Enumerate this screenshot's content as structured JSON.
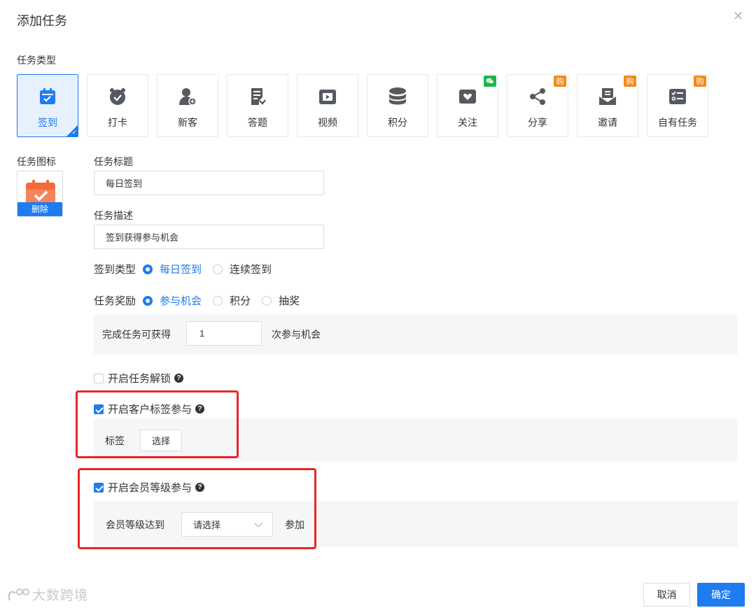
{
  "dialog": {
    "title": "添加任务"
  },
  "task_type": {
    "label": "任务类型",
    "items": [
      {
        "label": "签到",
        "icon": "calendar-check-icon"
      },
      {
        "label": "打卡",
        "icon": "alarm-clock-icon"
      },
      {
        "label": "新客",
        "icon": "new-user-icon"
      },
      {
        "label": "答题",
        "icon": "quiz-icon"
      },
      {
        "label": "视频",
        "icon": "video-icon"
      },
      {
        "label": "积分",
        "icon": "coins-icon"
      },
      {
        "label": "关注",
        "icon": "heart-message-icon",
        "badge_icon": "wechat-icon"
      },
      {
        "label": "分享",
        "icon": "share-icon",
        "badge": "购"
      },
      {
        "label": "邀请",
        "icon": "invite-icon",
        "badge": "购"
      },
      {
        "label": "自有任务",
        "icon": "checklist-icon",
        "badge": "购"
      }
    ]
  },
  "task_icon": {
    "label": "任务图标",
    "delete_label": "删除"
  },
  "task_title": {
    "label": "任务标题",
    "value": "每日签到"
  },
  "task_desc": {
    "label": "任务描述",
    "value": "签到获得参与机会"
  },
  "checkin_type": {
    "label": "签到类型",
    "options": [
      "每日签到",
      "连续签到"
    ],
    "selected": "每日签到"
  },
  "task_reward": {
    "label": "任务奖励",
    "options": [
      "参与机会",
      "积分",
      "抽奖"
    ],
    "selected": "参与机会"
  },
  "reward_detail": {
    "prefix": "完成任务可获得",
    "value": "1",
    "suffix": "次参与机会"
  },
  "unlock": {
    "label": "开启任务解锁",
    "checked": false
  },
  "customer_tag": {
    "label": "开启客户标签参与",
    "checked": true,
    "tag_label": "标签",
    "select_button": "选择"
  },
  "member_level": {
    "label": "开启会员等级参与",
    "checked": true,
    "level_label": "会员等级达到",
    "placeholder": "请选择",
    "suffix": "参加"
  },
  "footer": {
    "cancel": "取消",
    "ok": "确定",
    "watermark": "大数跨境"
  },
  "colors": {
    "primary": "#1e7cf0",
    "highlight": "#e8262a",
    "badge_orange": "#f38a14",
    "badge_green": "#1ab84a",
    "icon_gray": "#555a60"
  }
}
